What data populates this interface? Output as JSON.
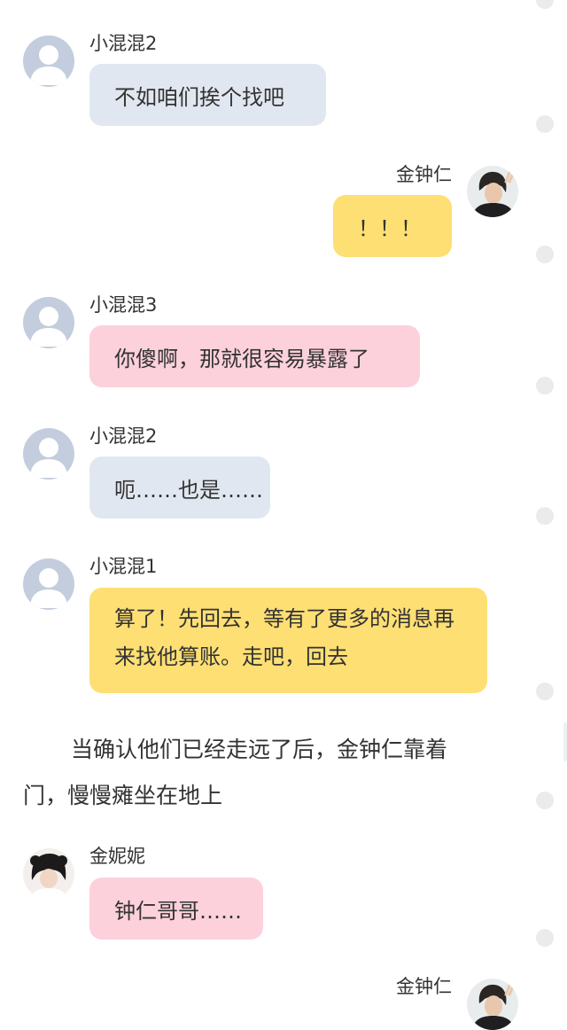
{
  "messages": [
    {
      "sender": "小混混2",
      "text": "不如咱们挨个找吧"
    },
    {
      "sender": "金钟仁",
      "text": "！！！"
    },
    {
      "sender": "小混混3",
      "text": "你傻啊，那就很容易暴露了"
    },
    {
      "sender": "小混混2",
      "text": "呃……也是……"
    },
    {
      "sender": "小混混1",
      "text": "算了！先回去，等有了更多的消息再来找他算账。走吧，回去"
    },
    {
      "sender": "金妮妮",
      "text": "钟仁哥哥……"
    },
    {
      "sender": "金钟仁"
    }
  ],
  "narration": "当确认他们已经走远了后，金钟仁靠着门，慢慢瘫坐在地上",
  "colors": {
    "bubble_blue": "#e1e7f0",
    "bubble_pink": "#fcd1dc",
    "bubble_yellow": "#fedf74",
    "avatar_default": "#c3cddd"
  },
  "icons": {
    "default_avatar": "default-user-avatar-icon",
    "character_avatar": "character-photo-avatar"
  }
}
